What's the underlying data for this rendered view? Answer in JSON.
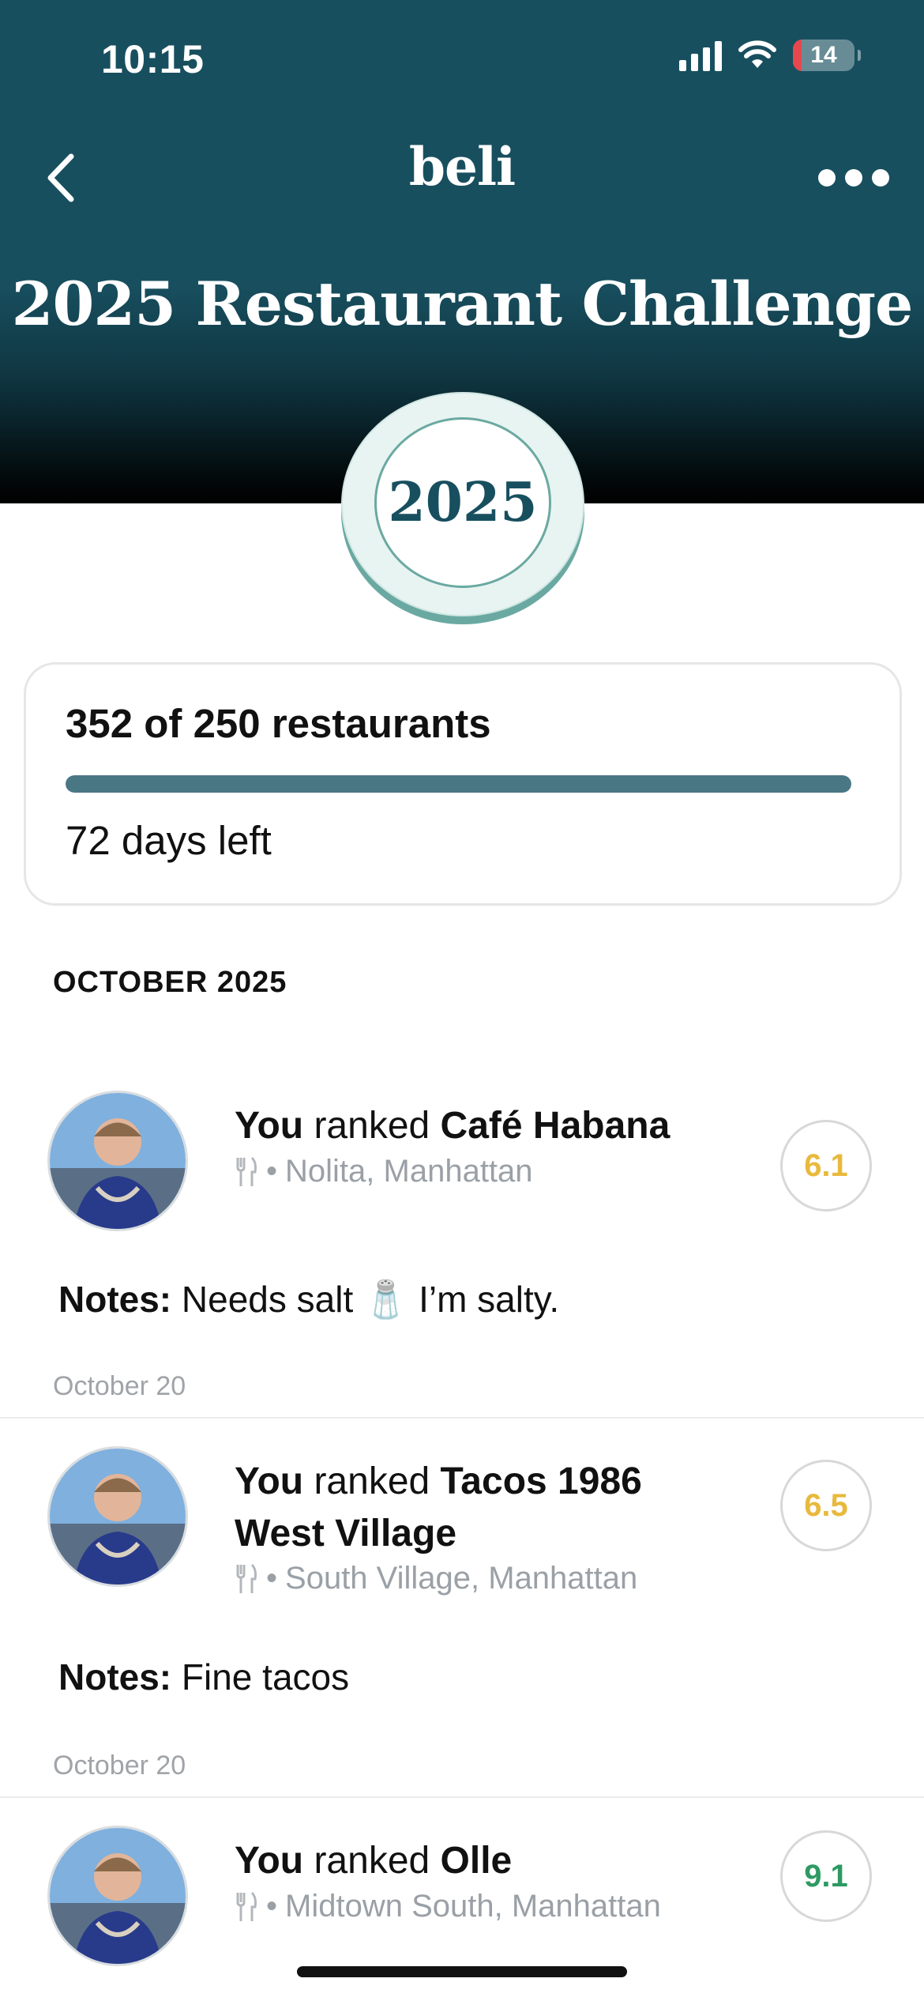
{
  "status_bar": {
    "time": "10:15",
    "battery_level": "14",
    "battery_fraction": 0.14,
    "icons": [
      "signal-icon",
      "wifi-icon",
      "battery-icon"
    ]
  },
  "nav": {
    "title": "beli",
    "back_icon": "chevron-left-icon",
    "more_icon": "more-horizontal-icon"
  },
  "challenge": {
    "title": "2025 Restaurant Challenge",
    "badge_year": "2025"
  },
  "progress": {
    "count_text": "352 of 250 restaurants",
    "completed": 352,
    "goal": 250,
    "fill_fraction": 1.0,
    "days_left": "72 days left"
  },
  "section": {
    "heading": "OCTOBER 2025"
  },
  "feed": [
    {
      "actor": "You",
      "verb": "ranked",
      "restaurant": "Café Habana",
      "location": "Nolita, Manhattan",
      "score": "6.1",
      "score_color": "#e8b93c",
      "notes_label": "Notes:",
      "notes": "Needs salt 🧂 I’m salty.",
      "date": "October 20"
    },
    {
      "actor": "You",
      "verb": "ranked",
      "restaurant": "Tacos 1986 West Village",
      "location": "South Village, Manhattan",
      "score": "6.5",
      "score_color": "#e8b93c",
      "notes_label": "Notes:",
      "notes": "Fine tacos",
      "date": "October 20"
    },
    {
      "actor": "You",
      "verb": "ranked",
      "restaurant": "Olle",
      "location": "Midtown South, Manhattan",
      "score": "9.1",
      "score_color": "#2e9a63"
    }
  ],
  "colors": {
    "header": "#184f5f",
    "progress_bar": "#4a7784",
    "score_mid": "#e8b93c",
    "score_high": "#2e9a63"
  }
}
